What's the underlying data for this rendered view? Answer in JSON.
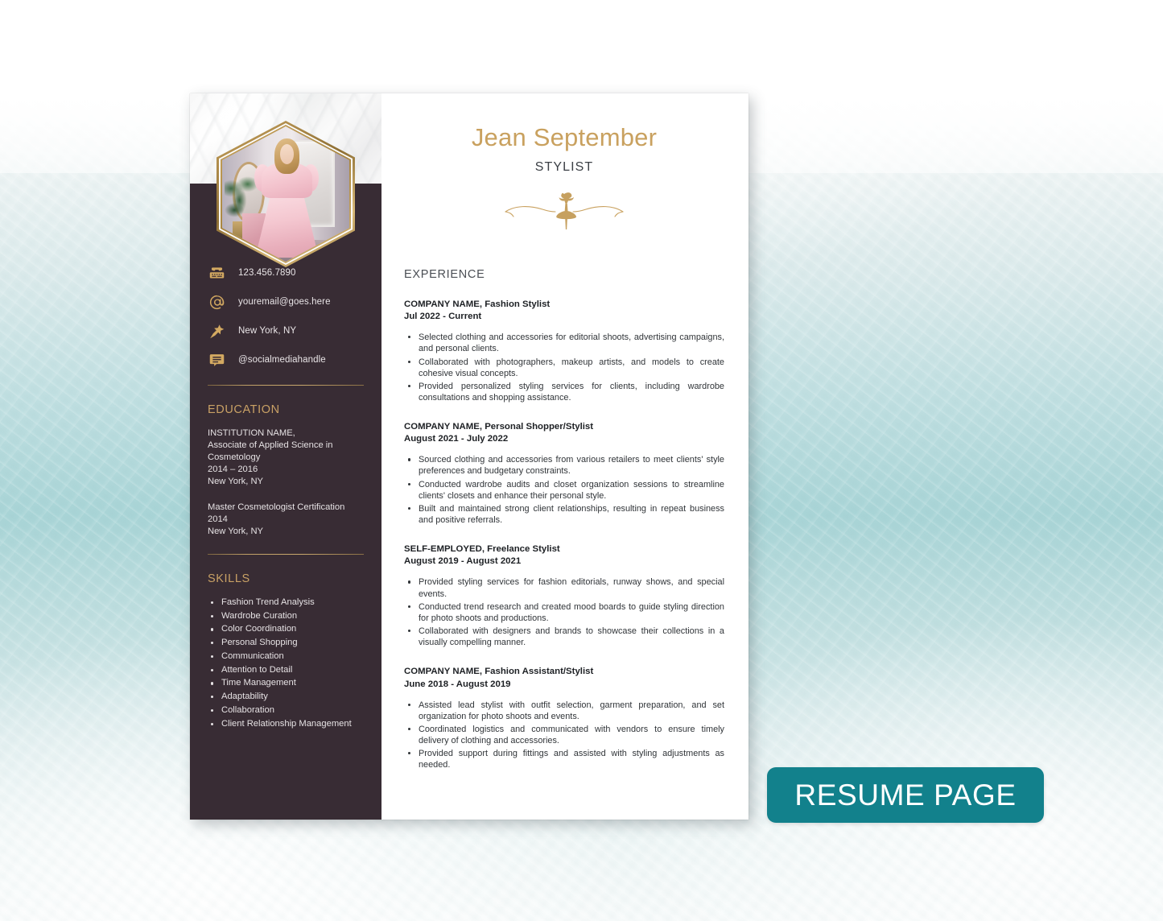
{
  "badge": {
    "label": "RESUME PAGE"
  },
  "header": {
    "name": "Jean September",
    "role": "STYLIST",
    "ornament_icon": "dancer-flourish-ornament",
    "name_color": "#c9a15f",
    "role_color": "#3c4046"
  },
  "sidebar": {
    "background_color": "#382c34",
    "accent_color": "#c9a165",
    "photo_alt": "woman-in-pink-dress-photo",
    "contacts": [
      {
        "icon": "phone-icon",
        "value": "123.456.7890"
      },
      {
        "icon": "at-sign-icon",
        "value": "youremail@goes.here"
      },
      {
        "icon": "pushpin-icon",
        "value": "New York, NY"
      },
      {
        "icon": "speech-bubble-icon",
        "value": "@socialmediahandle"
      }
    ],
    "education": {
      "heading": "EDUCATION",
      "entries": [
        {
          "text": "INSTITUTION NAME,\nAssociate of Applied Science in Cosmetology\n2014 – 2016\nNew York, NY"
        },
        {
          "text": "Master Cosmetologist Certification\n2014\nNew York, NY"
        }
      ]
    },
    "skills": {
      "heading": "SKILLS",
      "items": [
        "Fashion Trend Analysis",
        "Wardrobe Curation",
        "Color Coordination",
        "Personal Shopping",
        "Communication",
        "Attention to Detail",
        "Time Management",
        "Adaptability",
        "Collaboration",
        "Client Relationship Management"
      ]
    }
  },
  "main": {
    "experience_heading": "EXPERIENCE",
    "jobs": [
      {
        "title": "COMPANY NAME, Fashion Stylist",
        "date": "Jul 2022 - Current",
        "duties": [
          "Selected clothing and accessories for editorial shoots, advertising campaigns, and personal clients.",
          "Collaborated with photographers, makeup artists, and models to create cohesive visual concepts.",
          "Provided personalized styling services for clients, including wardrobe consultations and shopping assistance."
        ]
      },
      {
        "title": "COMPANY NAME, Personal Shopper/Stylist",
        "date": "August 2021 - July 2022",
        "duties": [
          "Sourced clothing and accessories from various retailers to meet clients' style preferences and budgetary constraints.",
          "Conducted wardrobe audits and closet organization sessions to streamline clients' closets and enhance their personal style.",
          "Built and maintained strong client relationships, resulting in repeat business and positive referrals."
        ]
      },
      {
        "title": "SELF-EMPLOYED, Freelance Stylist",
        "date": "August 2019 - August 2021",
        "duties": [
          "Provided styling services for fashion editorials, runway shows, and special events.",
          "Conducted trend research and created mood boards to guide styling direction for photo shoots and productions.",
          "Collaborated with designers and brands to showcase their collections in a visually compelling manner."
        ]
      },
      {
        "title": "COMPANY NAME, Fashion Assistant/Stylist",
        "date": "June 2018 - August 2019",
        "duties": [
          "Assisted lead stylist with outfit selection, garment preparation, and set organization for photo shoots and events.",
          "Coordinated logistics and communicated with vendors to ensure timely delivery of clothing and accessories.",
          "Provided support during fittings and assisted with styling adjustments as needed."
        ]
      }
    ]
  }
}
